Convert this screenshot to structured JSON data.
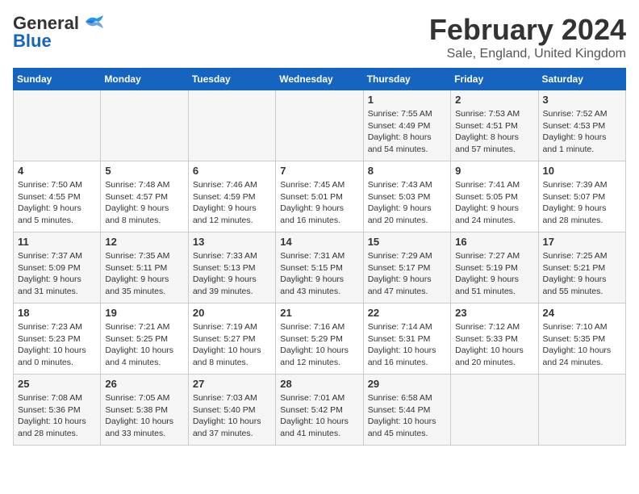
{
  "header": {
    "logo_general": "General",
    "logo_blue": "Blue",
    "title": "February 2024",
    "subtitle": "Sale, England, United Kingdom"
  },
  "days_of_week": [
    "Sunday",
    "Monday",
    "Tuesday",
    "Wednesday",
    "Thursday",
    "Friday",
    "Saturday"
  ],
  "weeks": [
    [
      {
        "day": "",
        "info": ""
      },
      {
        "day": "",
        "info": ""
      },
      {
        "day": "",
        "info": ""
      },
      {
        "day": "",
        "info": ""
      },
      {
        "day": "1",
        "info": "Sunrise: 7:55 AM\nSunset: 4:49 PM\nDaylight: 8 hours\nand 54 minutes."
      },
      {
        "day": "2",
        "info": "Sunrise: 7:53 AM\nSunset: 4:51 PM\nDaylight: 8 hours\nand 57 minutes."
      },
      {
        "day": "3",
        "info": "Sunrise: 7:52 AM\nSunset: 4:53 PM\nDaylight: 9 hours\nand 1 minute."
      }
    ],
    [
      {
        "day": "4",
        "info": "Sunrise: 7:50 AM\nSunset: 4:55 PM\nDaylight: 9 hours\nand 5 minutes."
      },
      {
        "day": "5",
        "info": "Sunrise: 7:48 AM\nSunset: 4:57 PM\nDaylight: 9 hours\nand 8 minutes."
      },
      {
        "day": "6",
        "info": "Sunrise: 7:46 AM\nSunset: 4:59 PM\nDaylight: 9 hours\nand 12 minutes."
      },
      {
        "day": "7",
        "info": "Sunrise: 7:45 AM\nSunset: 5:01 PM\nDaylight: 9 hours\nand 16 minutes."
      },
      {
        "day": "8",
        "info": "Sunrise: 7:43 AM\nSunset: 5:03 PM\nDaylight: 9 hours\nand 20 minutes."
      },
      {
        "day": "9",
        "info": "Sunrise: 7:41 AM\nSunset: 5:05 PM\nDaylight: 9 hours\nand 24 minutes."
      },
      {
        "day": "10",
        "info": "Sunrise: 7:39 AM\nSunset: 5:07 PM\nDaylight: 9 hours\nand 28 minutes."
      }
    ],
    [
      {
        "day": "11",
        "info": "Sunrise: 7:37 AM\nSunset: 5:09 PM\nDaylight: 9 hours\nand 31 minutes."
      },
      {
        "day": "12",
        "info": "Sunrise: 7:35 AM\nSunset: 5:11 PM\nDaylight: 9 hours\nand 35 minutes."
      },
      {
        "day": "13",
        "info": "Sunrise: 7:33 AM\nSunset: 5:13 PM\nDaylight: 9 hours\nand 39 minutes."
      },
      {
        "day": "14",
        "info": "Sunrise: 7:31 AM\nSunset: 5:15 PM\nDaylight: 9 hours\nand 43 minutes."
      },
      {
        "day": "15",
        "info": "Sunrise: 7:29 AM\nSunset: 5:17 PM\nDaylight: 9 hours\nand 47 minutes."
      },
      {
        "day": "16",
        "info": "Sunrise: 7:27 AM\nSunset: 5:19 PM\nDaylight: 9 hours\nand 51 minutes."
      },
      {
        "day": "17",
        "info": "Sunrise: 7:25 AM\nSunset: 5:21 PM\nDaylight: 9 hours\nand 55 minutes."
      }
    ],
    [
      {
        "day": "18",
        "info": "Sunrise: 7:23 AM\nSunset: 5:23 PM\nDaylight: 10 hours\nand 0 minutes."
      },
      {
        "day": "19",
        "info": "Sunrise: 7:21 AM\nSunset: 5:25 PM\nDaylight: 10 hours\nand 4 minutes."
      },
      {
        "day": "20",
        "info": "Sunrise: 7:19 AM\nSunset: 5:27 PM\nDaylight: 10 hours\nand 8 minutes."
      },
      {
        "day": "21",
        "info": "Sunrise: 7:16 AM\nSunset: 5:29 PM\nDaylight: 10 hours\nand 12 minutes."
      },
      {
        "day": "22",
        "info": "Sunrise: 7:14 AM\nSunset: 5:31 PM\nDaylight: 10 hours\nand 16 minutes."
      },
      {
        "day": "23",
        "info": "Sunrise: 7:12 AM\nSunset: 5:33 PM\nDaylight: 10 hours\nand 20 minutes."
      },
      {
        "day": "24",
        "info": "Sunrise: 7:10 AM\nSunset: 5:35 PM\nDaylight: 10 hours\nand 24 minutes."
      }
    ],
    [
      {
        "day": "25",
        "info": "Sunrise: 7:08 AM\nSunset: 5:36 PM\nDaylight: 10 hours\nand 28 minutes."
      },
      {
        "day": "26",
        "info": "Sunrise: 7:05 AM\nSunset: 5:38 PM\nDaylight: 10 hours\nand 33 minutes."
      },
      {
        "day": "27",
        "info": "Sunrise: 7:03 AM\nSunset: 5:40 PM\nDaylight: 10 hours\nand 37 minutes."
      },
      {
        "day": "28",
        "info": "Sunrise: 7:01 AM\nSunset: 5:42 PM\nDaylight: 10 hours\nand 41 minutes."
      },
      {
        "day": "29",
        "info": "Sunrise: 6:58 AM\nSunset: 5:44 PM\nDaylight: 10 hours\nand 45 minutes."
      },
      {
        "day": "",
        "info": ""
      },
      {
        "day": "",
        "info": ""
      }
    ]
  ]
}
